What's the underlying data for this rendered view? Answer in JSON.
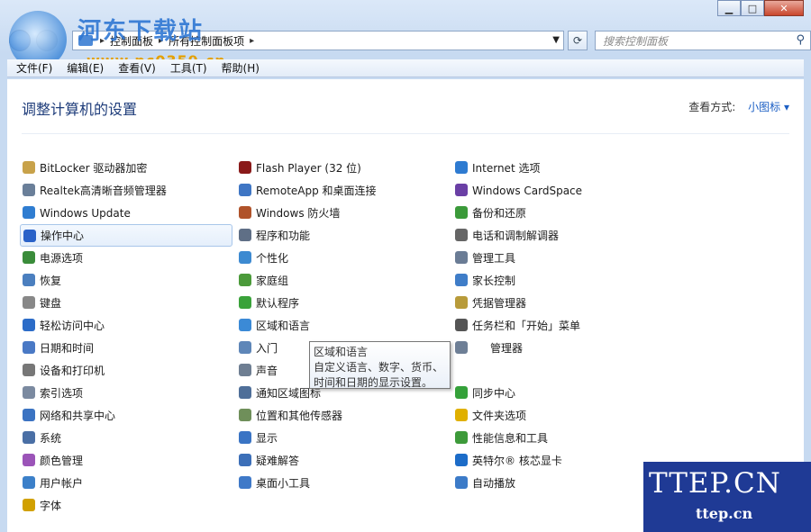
{
  "window": {
    "caption": {
      "minimize": "▁",
      "maximize": "□",
      "close": "✕"
    }
  },
  "address": {
    "crumbs": [
      "控制面板",
      "所有控制面板项"
    ],
    "search_placeholder": "搜索控制面板"
  },
  "menu": [
    "文件(F)",
    "编辑(E)",
    "查看(V)",
    "工具(T)",
    "帮助(H)"
  ],
  "content": {
    "title": "调整计算机的设置",
    "view_by_label": "查看方式:",
    "view_by_value": "小图标 ▾"
  },
  "items": {
    "col0": [
      {
        "label": "BitLocker 驱动器加密",
        "icon": "key-icon",
        "color": "#c8a24a"
      },
      {
        "label": "Realtek高清晰音频管理器",
        "icon": "speaker-icon",
        "color": "#6a7f99"
      },
      {
        "label": "Windows Update",
        "icon": "update-icon",
        "color": "#2f7dd1"
      },
      {
        "label": "操作中心",
        "icon": "flag-icon",
        "color": "#2a62c8",
        "selected": true
      },
      {
        "label": "电源选项",
        "icon": "power-icon",
        "color": "#3a8c3a"
      },
      {
        "label": "恢复",
        "icon": "recovery-icon",
        "color": "#4b7fbf"
      },
      {
        "label": "键盘",
        "icon": "keyboard-icon",
        "color": "#888888"
      },
      {
        "label": "轻松访问中心",
        "icon": "accessibility-icon",
        "color": "#2c6cc8"
      },
      {
        "label": "日期和时间",
        "icon": "clock-icon",
        "color": "#4a79c5"
      },
      {
        "label": "设备和打印机",
        "icon": "printer-icon",
        "color": "#777777"
      },
      {
        "label": "索引选项",
        "icon": "index-icon",
        "color": "#7b8aa0"
      },
      {
        "label": "网络和共享中心",
        "icon": "network-icon",
        "color": "#3b73c2"
      },
      {
        "label": "系统",
        "icon": "system-icon",
        "color": "#4a6fa5"
      },
      {
        "label": "颜色管理",
        "icon": "color-icon",
        "color": "#9b54b8"
      },
      {
        "label": "用户帐户",
        "icon": "users-icon",
        "color": "#3c80c9"
      },
      {
        "label": "字体",
        "icon": "font-icon",
        "color": "#d1a000"
      }
    ],
    "col1": [
      {
        "label": "Flash Player (32 位)",
        "icon": "flash-icon",
        "color": "#8a1a1a"
      },
      {
        "label": "RemoteApp 和桌面连接",
        "icon": "remote-icon",
        "color": "#3f76c4"
      },
      {
        "label": "Windows 防火墙",
        "icon": "firewall-icon",
        "color": "#b0532a"
      },
      {
        "label": "程序和功能",
        "icon": "programs-icon",
        "color": "#5f6f86"
      },
      {
        "label": "个性化",
        "icon": "personalize-icon",
        "color": "#3d8ad1"
      },
      {
        "label": "家庭组",
        "icon": "homegroup-icon",
        "color": "#4b9a3a"
      },
      {
        "label": "默认程序",
        "icon": "default-programs-icon",
        "color": "#3aa23a"
      },
      {
        "label": "区域和语言",
        "icon": "globe-icon",
        "color": "#3b8ad6"
      },
      {
        "label": "入门",
        "icon": "getting-started-icon",
        "color": "#5e86b8"
      },
      {
        "label": "声音",
        "icon": "sound-icon",
        "color": "#6e7e92"
      },
      {
        "label": "通知区域图标",
        "icon": "notification-icon",
        "color": "#4f6f99"
      },
      {
        "label": "位置和其他传感器",
        "icon": "sensor-icon",
        "color": "#6f8f5a"
      },
      {
        "label": "显示",
        "icon": "display-icon",
        "color": "#3a74c4"
      },
      {
        "label": "疑难解答",
        "icon": "troubleshoot-icon",
        "color": "#3c6fb8"
      },
      {
        "label": "桌面小工具",
        "icon": "gadget-icon",
        "color": "#3f79c8"
      }
    ],
    "col2": [
      {
        "label": "Internet 选项",
        "icon": "internet-icon",
        "color": "#2e7bd1"
      },
      {
        "label": "Windows CardSpace",
        "icon": "cardspace-icon",
        "color": "#6a3fa5"
      },
      {
        "label": "备份和还原",
        "icon": "backup-icon",
        "color": "#3b9a3a"
      },
      {
        "label": "电话和调制解调器",
        "icon": "phone-icon",
        "color": "#666666"
      },
      {
        "label": "管理工具",
        "icon": "admin-icon",
        "color": "#6a7c95"
      },
      {
        "label": "家长控制",
        "icon": "parental-icon",
        "color": "#3f7dc8"
      },
      {
        "label": "凭据管理器",
        "icon": "credential-icon",
        "color": "#b89b3a"
      },
      {
        "label": "任务栏和「开始」菜单",
        "icon": "taskbar-icon",
        "color": "#555555"
      },
      {
        "label": "管理器",
        "icon": "device-manager-icon",
        "color": "#6e7f96",
        "offset": 20
      },
      {
        "label": "",
        "icon": "hidden-icon",
        "color": "#ffffff"
      },
      {
        "label": "同步中心",
        "icon": "sync-icon",
        "color": "#35a13a"
      },
      {
        "label": "文件夹选项",
        "icon": "folder-icon",
        "color": "#e0b000"
      },
      {
        "label": "性能信息和工具",
        "icon": "performance-icon",
        "color": "#3d9a3a"
      },
      {
        "label": "英特尔® 核芯显卡",
        "icon": "intel-icon",
        "color": "#1c6cc8"
      },
      {
        "label": "自动播放",
        "icon": "autoplay-icon",
        "color": "#3c7bc8"
      }
    ]
  },
  "tooltip": {
    "title": "区域和语言",
    "text": "自定义语言、数字、货币、时间和日期的显示设置。"
  },
  "watermarks": {
    "top_title": "河东下载站",
    "top_url": "www.pc0359.cn",
    "ttep_big": "TTEP.CN",
    "ttep_small": "ttep.cn"
  }
}
